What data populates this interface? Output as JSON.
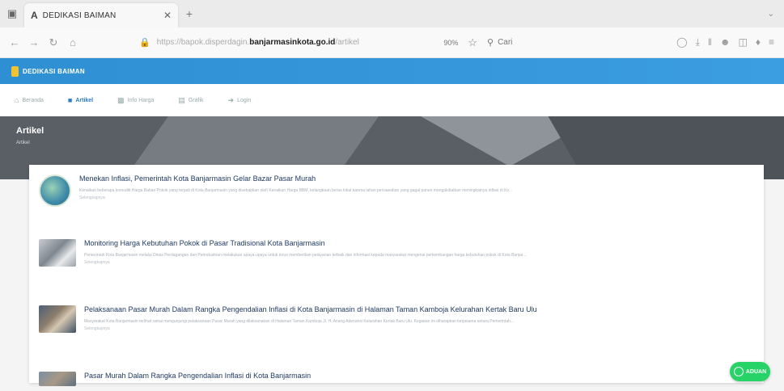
{
  "browser": {
    "tab_title": "DEDIKASI BAIMAN",
    "tab_favicon": "A",
    "url_prefix": "https://bapok.disperdagin.",
    "url_host": "banjarmasinkota.go.id",
    "url_path": "/artikel",
    "zoom": "90%",
    "search_placeholder": "Cari"
  },
  "site": {
    "logo_text": "DEDIKASI BAIMAN",
    "nav": [
      {
        "label": "Beranda",
        "icon": "home-icon",
        "active": false
      },
      {
        "label": "Artikel",
        "icon": "article-icon",
        "active": true
      },
      {
        "label": "Info Harga",
        "icon": "price-icon",
        "active": false
      },
      {
        "label": "Grafik",
        "icon": "chart-icon",
        "active": false
      },
      {
        "label": "Login",
        "icon": "login-icon",
        "active": false
      }
    ]
  },
  "banner": {
    "title": "Artikel",
    "breadcrumb": "Artikel"
  },
  "articles": [
    {
      "title": "Menekan Inflasi, Pemerintah Kota Banjarmasin Gelar Bazar Pasar Murah",
      "desc": "Kenaikan beberapa komoditi Harga Bahan Pokok yang terjadi di Kota Banjarmasin yang disebabkan oleh Kenaikan Harga BBM, kelangkaan beras lokal karena lahan persawahan yang gagal panen mengakibatkan meningkatnya inflasi di Ko...",
      "more": "Selengkapnya"
    },
    {
      "title": "Monitoring Harga Kebutuhan Pokok di Pasar Tradisional Kota Banjarmasin",
      "desc": "Pemerintah Kota Banjarmasin melalui Dinas Perdagangan dan Perindustrian melakukan upaya-upaya untuk terus memberikan pelayanan terbaik dan informasi kepada masyarakat mengenai perkembangan harga kebutuhan pokok di Kota Banjar...",
      "more": "Selengkapnya"
    },
    {
      "title": "Pelaksanaan Pasar Murah Dalam Rangka Pengendalian Inflasi di Kota Banjarmasin di Halaman Taman Kamboja Kelurahan Kertak Baru Ulu",
      "desc": "Masyarakat Kota Banjarmasin terlihat ramai mengunjungi pelaksanaan Pasar Murah yang dilaksanakan di Halaman Taman Kamboja Jl. H. Anang Adenansi Kelurahan Kertak Baru Ulu. Kegiatan ini diharapkan kerjasama antara Pemerintah...",
      "more": "Selengkapnya"
    },
    {
      "title": "Pasar Murah Dalam Rangka Pengendalian Inflasi di Kota Banjarmasin",
      "desc": "",
      "more": ""
    }
  ],
  "whatsapp": {
    "label": "ADUAN",
    "color": "#25d366"
  }
}
